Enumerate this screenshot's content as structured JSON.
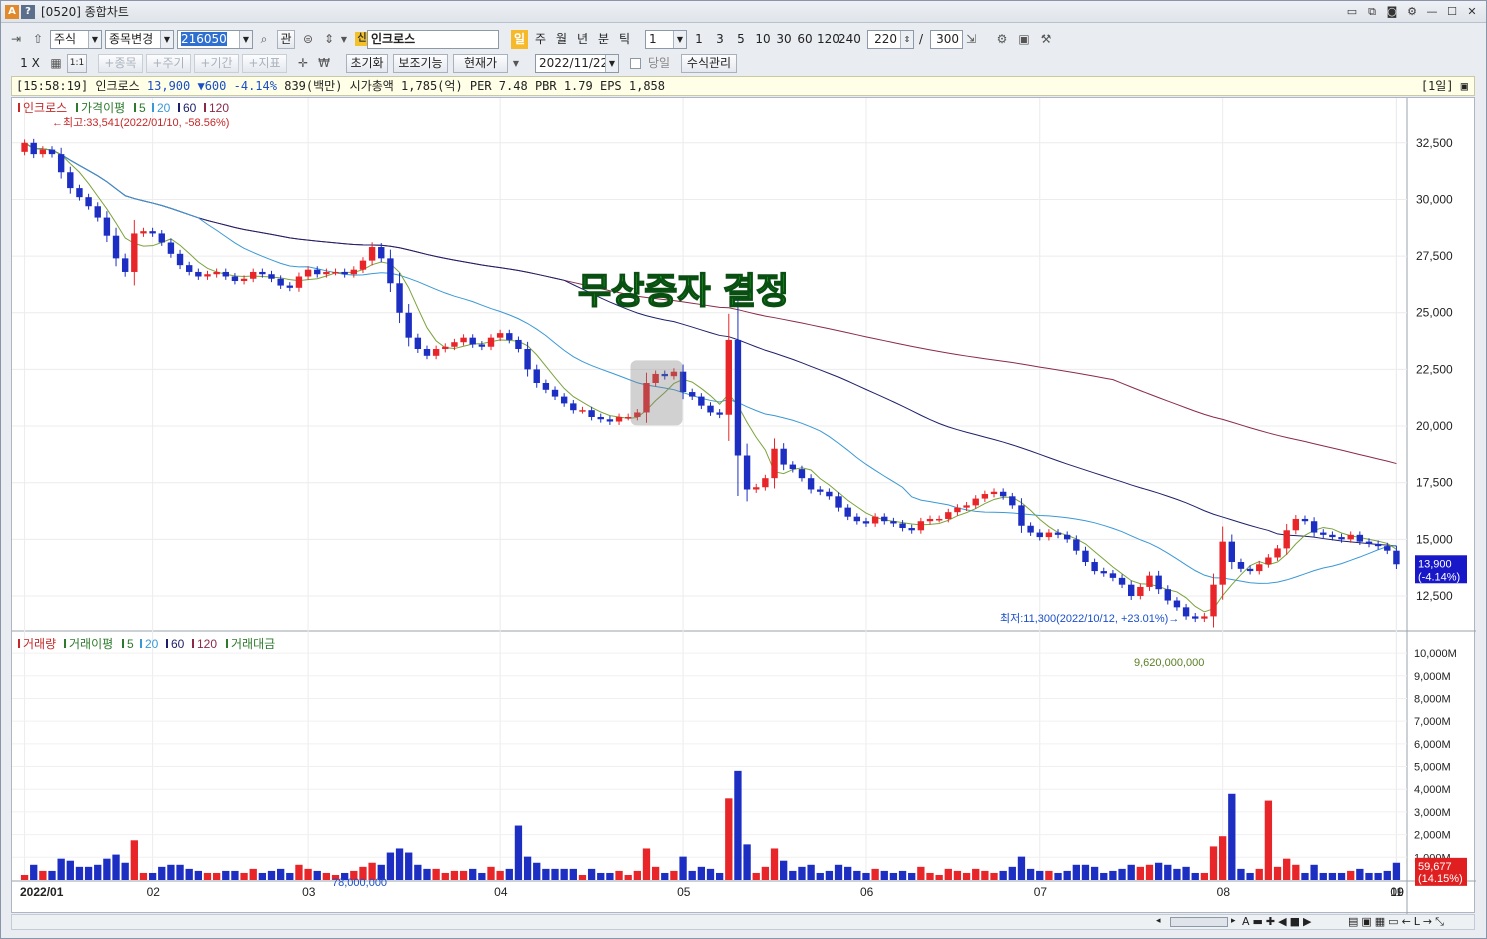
{
  "window": {
    "title": "[0520] 종합차트",
    "icon_a": "A",
    "icon_q": "?"
  },
  "toolbar": {
    "market": "주식",
    "stock_change": "종목변경",
    "code": "216050",
    "watch": "관",
    "badge_sin": "신",
    "stock_name": "인크로스",
    "periods": [
      "일",
      "주",
      "월",
      "년",
      "분",
      "틱"
    ],
    "interval": "1",
    "intervals": [
      "1",
      "3",
      "5",
      "10",
      "30",
      "60",
      "120",
      "240"
    ],
    "view_count": "220",
    "slash": "/",
    "total_count": "300"
  },
  "toolbar2": {
    "layout": "1 X 1",
    "one_one": "1:1",
    "btn_stock": "+종목",
    "btn_period": "+주기",
    "btn_range": "+기간",
    "btn_indicator": "+지표",
    "btn_reset": "초기화",
    "btn_aux": "보조기능",
    "btn_price": "현재가",
    "date": "2022/11/22",
    "same_day": "당일",
    "btn_formula": "수식관리"
  },
  "info": {
    "time": "[15:58:19]",
    "name": "인크로스",
    "price": "13,900",
    "change": "▼600",
    "rate": "-4.14%",
    "volume": "839(백만)",
    "mcap": "시가총액 1,785(억)",
    "per": "PER 7.48",
    "pbr": "PBR 1.79",
    "eps": "EPS 1,858",
    "period": "[1일]"
  },
  "chart_data": [
    {
      "type": "candlestick",
      "legend": [
        "인크로스",
        "가격이평",
        "5",
        "20",
        "60",
        "120"
      ],
      "colors": {
        "up": "#e8262a",
        "down": "#1c2fc2",
        "ma5": "#7aa33b",
        "ma20": "#3a98d6",
        "ma60": "#1e1f6b",
        "ma120": "#8a2a48"
      },
      "ylim": [
        11000,
        34300
      ],
      "yticks": [
        "32,500",
        "30,000",
        "27,500",
        "25,000",
        "22,500",
        "20,000",
        "17,500",
        "15,000",
        "12,500"
      ],
      "ytick_values": [
        32500,
        30000,
        27500,
        25000,
        22500,
        20000,
        17500,
        15000,
        12500
      ],
      "annotations": {
        "high": "←최고:33,541(2022/01/10, -58.56%)",
        "low": "최저:11,300(2022/10/12, +23.01%)→",
        "headline": "무상증자 결정"
      },
      "last_price": "13,900",
      "last_change": "(-4.14%)",
      "closes": [
        32500,
        32000,
        32200,
        32000,
        31200,
        30500,
        30100,
        29700,
        29200,
        28400,
        27400,
        26800,
        28500,
        28600,
        28500,
        28100,
        27600,
        27100,
        26800,
        26600,
        26700,
        26800,
        26600,
        26400,
        26500,
        26800,
        26700,
        26500,
        26200,
        26100,
        26600,
        26900,
        26700,
        26800,
        26800,
        26700,
        26900,
        27300,
        27900,
        27400,
        26300,
        25000,
        23900,
        23400,
        23100,
        23400,
        23500,
        23700,
        23900,
        23600,
        23500,
        23900,
        24100,
        23800,
        23400,
        22500,
        21900,
        21600,
        21300,
        21000,
        20700,
        20700,
        20400,
        20300,
        20200,
        20400,
        20400,
        20600,
        21900,
        22300,
        22200,
        22400,
        21500,
        21300,
        20900,
        20600,
        20500,
        23800,
        18700,
        17200,
        17300,
        17700,
        19000,
        18300,
        18100,
        17700,
        17200,
        17100,
        16900,
        16400,
        16000,
        15800,
        15700,
        16000,
        15800,
        15700,
        15500,
        15400,
        15800,
        15900,
        15900,
        16200,
        16400,
        16500,
        16800,
        17000,
        17100,
        16900,
        16500,
        15600,
        15300,
        15100,
        15300,
        15200,
        15000,
        14500,
        14000,
        13600,
        13500,
        13300,
        13000,
        12500,
        12900,
        13400,
        12800,
        12300,
        12000,
        11600,
        11500,
        11600,
        13000,
        14900,
        14000,
        13700,
        13600,
        13900,
        14200,
        14600,
        15400,
        15900,
        15800,
        15300,
        15200,
        15100,
        15000,
        15200,
        14900,
        14800,
        14700,
        14500,
        13900
      ],
      "volume_panel": {
        "legend": [
          "거래량",
          "거래이평",
          "5",
          "20",
          "60",
          "120",
          "거래대금"
        ],
        "yticks": [
          "10,000M",
          "9,000M",
          "8,000M",
          "7,000M",
          "6,000M",
          "5,000M",
          "4,000M",
          "3,000M",
          "2,000M",
          "1,000M"
        ],
        "max_label": "9,620,000,000",
        "min_label": "78,000,000",
        "last_value": "59,677",
        "last_rate": "(14.15%)"
      },
      "x_labels": [
        "2022/01",
        "02",
        "03",
        "04",
        "05",
        "06",
        "07",
        "08",
        "09",
        "10",
        "11"
      ]
    }
  ]
}
